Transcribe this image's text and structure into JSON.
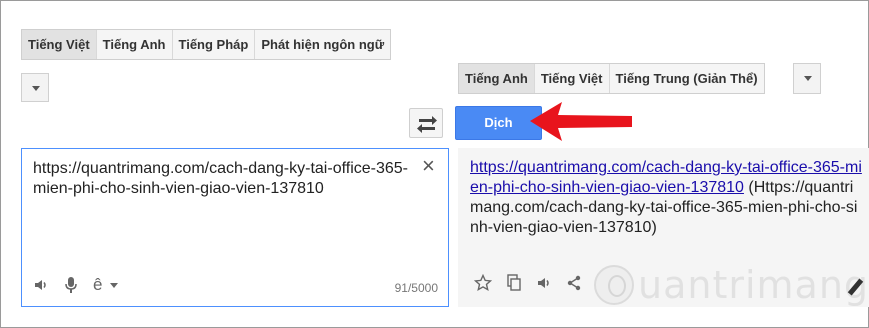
{
  "source_lang_tabs": [
    "Tiếng Việt",
    "Tiếng Anh",
    "Tiếng Pháp",
    "Phát hiện ngôn ngữ"
  ],
  "target_lang_tabs": [
    "Tiếng Anh",
    "Tiếng Việt",
    "Tiếng Trung (Giản Thể)"
  ],
  "translate_button": "Dịch",
  "source": {
    "text": "https://quantrimang.com/cach-dang-ky-tai-office-365-mien-phi-cho-sinh-vien-giao-vien-137810",
    "input_tool_label": "ê",
    "char_count": "91/5000"
  },
  "result": {
    "link_text": "https://quantrimang.com/cach-dang-ky-tai-office-365-mien-phi-cho-sinh-vien-giao-vien-137810",
    "plain_text": " (Https://quantrimang.com/cach-dang-ky-tai-office-365-mien-phi-cho-sinh-vien-giao-vien-137810)"
  },
  "watermark": "uantrimang",
  "colors": {
    "accent": "#4a8af4",
    "arrow": "#e8141c",
    "link": "#1a0dab"
  }
}
